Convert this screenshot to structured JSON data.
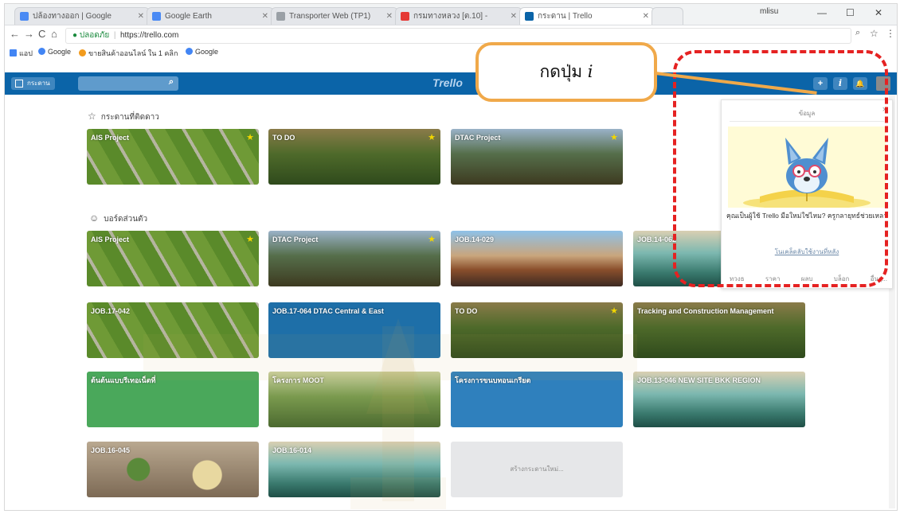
{
  "browser": {
    "tabs": [
      {
        "label": "ปล้องทางออก | Google",
        "favicon_color": "#4a8af4"
      },
      {
        "label": "Google Earth",
        "favicon_color": "#4a8af4"
      },
      {
        "label": "Transporter Web (TP1)",
        "favicon_color": "#9aa0a6"
      },
      {
        "label": "กรมทางหลวง [ต.10] -",
        "favicon_color": "#e53935"
      },
      {
        "label": "กระดาน | Trello",
        "favicon_color": "#0b64a8"
      }
    ],
    "window_user": "mlisu",
    "window_controls": [
      "—",
      "☐",
      "✕"
    ],
    "nav": {
      "back": "←",
      "forward": "→",
      "reload": "C",
      "home": "⌂"
    },
    "security_label": "ปลอดภัย",
    "url": "https://trello.com",
    "bookmarks": [
      {
        "label": "แอป",
        "color": "#4285f4"
      },
      {
        "label": "Google",
        "color": "#4285f4"
      },
      {
        "label": "ขายสินค้าออนไลน์ ใน 1 คลิก",
        "color": "#f29b1d"
      },
      {
        "label": "Google",
        "color": "#4285f4"
      }
    ]
  },
  "trello": {
    "boards_button": "กระดาน",
    "logo": "Trello",
    "header_buttons": {
      "add": "+",
      "info": "i",
      "notifications": "🔔"
    },
    "starred_title": "กระดานที่ติดดาว",
    "personal_title": "บอร์ดส่วนตัว",
    "starred": [
      {
        "name": "AIS Project",
        "style": "field",
        "starred": "★"
      },
      {
        "name": "TO DO",
        "style": "mount",
        "starred": "★"
      },
      {
        "name": "DTAC Project",
        "style": "lake",
        "starred": "★"
      }
    ],
    "boards": [
      {
        "name": "AIS Project",
        "style": "field",
        "starred": "★"
      },
      {
        "name": "DTAC Project",
        "style": "lake",
        "starred": "★"
      },
      {
        "name": "JOB.14-029",
        "style": "road",
        "starred": ""
      },
      {
        "name": "JOB.14-062",
        "style": "beach",
        "starred": ""
      },
      {
        "name": "JOB.17-042",
        "style": "field",
        "starred": ""
      },
      {
        "name": "JOB.17-064 DTAC Central & East",
        "style": "blue",
        "starred": ""
      },
      {
        "name": "TO DO",
        "style": "mount",
        "starred": "★"
      },
      {
        "name": "Tracking and Construction Management",
        "style": "mount",
        "starred": ""
      },
      {
        "name": "ต้นต้นแบบรีเทอเน็ตที่",
        "style": "green",
        "starred": ""
      },
      {
        "name": "โครงการ MOOT",
        "style": "valley",
        "starred": ""
      },
      {
        "name": "โครงการขนบทอนเกรียต",
        "style": "blue2",
        "starred": ""
      },
      {
        "name": "JOB.13-046 NEW SITE BKK REGION",
        "style": "beach",
        "starred": ""
      },
      {
        "name": "JOB.16-045",
        "style": "food",
        "starred": ""
      },
      {
        "name": "JOB.16-014",
        "style": "beach",
        "starred": ""
      },
      {
        "name": "สร้างกระดานใหม่...",
        "style": "new",
        "starred": ""
      }
    ],
    "info_popup": {
      "title": "ข้อมูล",
      "close": "×",
      "message": "คุณเป็นผู้ใช้ Trello มือใหม่ใช่ไหม? ครูกลายุทธ์ช่วยเหลา",
      "link": "โนเคล็ดลับใช้งานที่หลัง",
      "footer": [
        "ทวงธ",
        "ราคา",
        "ผลบ",
        "บล็อก",
        "อื่นๆ..."
      ]
    }
  },
  "annotation": {
    "callout_text": "กดปุ่ม",
    "callout_italic": "i",
    "highlight_color": "#e52222",
    "callout_border_color": "#f0a94a"
  }
}
